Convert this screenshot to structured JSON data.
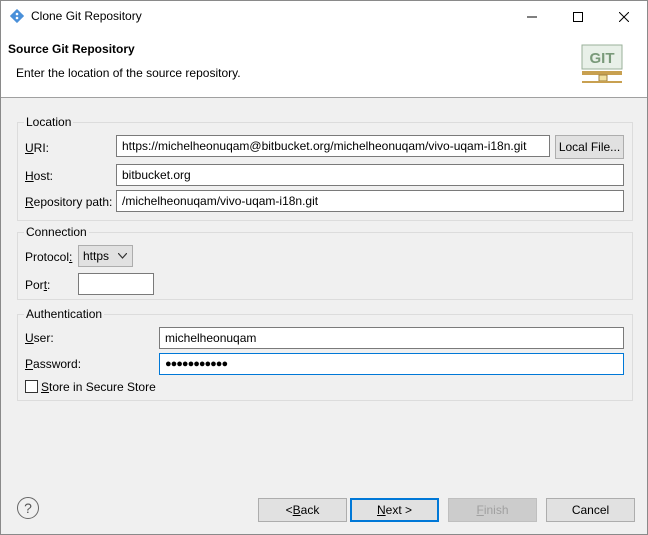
{
  "window": {
    "title": "Clone Git Repository",
    "minimize_icon": "minimize-icon",
    "maximize_icon": "maximize-icon",
    "close_icon": "close-icon"
  },
  "header": {
    "title": "Source Git Repository",
    "description": "Enter the location of the source repository.",
    "logo_text": "GIT"
  },
  "location": {
    "group_label": "Location",
    "uri_label_u": "U",
    "uri_label_rest": "RI:",
    "uri_value": "https://michelheonuqam@bitbucket.org/michelheonuqam/vivo-uqam-i18n.git",
    "local_file_button": "Local File...",
    "host_label_u": "H",
    "host_label_rest": "ost:",
    "host_value": "bitbucket.org",
    "repo_path_label_u": "R",
    "repo_path_label_rest": "epository path:",
    "repo_path_value": "/michelheonuqam/vivo-uqam-i18n.git"
  },
  "connection": {
    "group_label": "Connection",
    "protocol_label_pre": "Protocol",
    "protocol_label_u": ":",
    "protocol_value": "https",
    "port_label_pre": "Por",
    "port_label_u": "t",
    "port_label_rest": ":",
    "port_value": ""
  },
  "authentication": {
    "group_label": "Authentication",
    "user_label_u": "U",
    "user_label_rest": "ser:",
    "user_value": "michelheonuqam",
    "password_label_u": "P",
    "password_label_rest": "assword:",
    "password_value": "●●●●●●●●●●●",
    "store_label_u": "S",
    "store_label_rest": "tore in Secure Store",
    "store_checked": false
  },
  "footer": {
    "help_symbol": "?",
    "back_pre": "< ",
    "back_u": "B",
    "back_rest": "ack",
    "next_u": "N",
    "next_rest": "ext >",
    "finish_u": "F",
    "finish_rest": "inish",
    "cancel": "Cancel"
  }
}
